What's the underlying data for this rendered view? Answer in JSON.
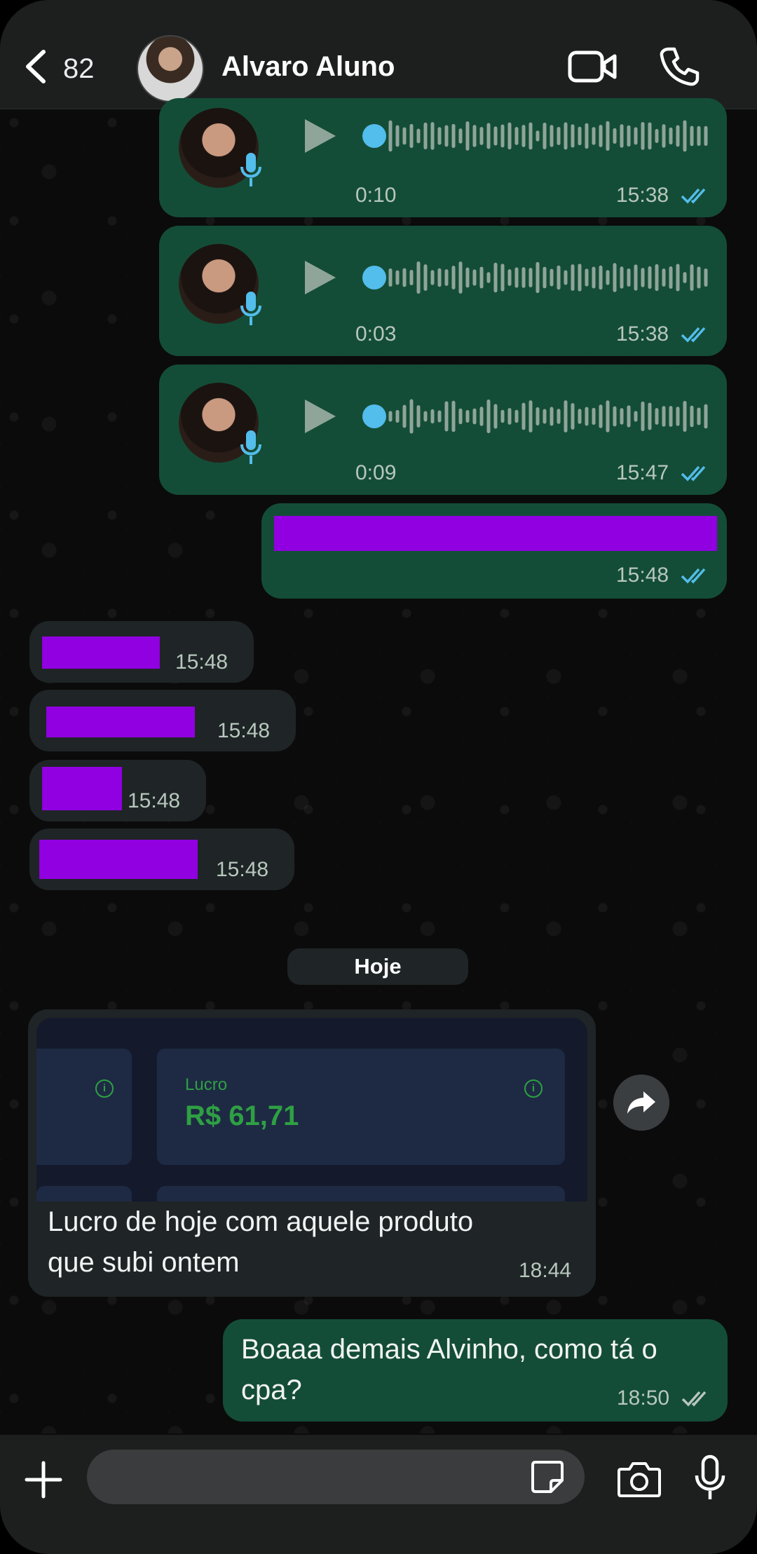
{
  "header": {
    "unread_count": "82",
    "contact_name": "Alvaro Aluno"
  },
  "voice_messages": [
    {
      "duration": "0:10",
      "time": "15:38"
    },
    {
      "duration": "0:03",
      "time": "15:38"
    },
    {
      "duration": "0:09",
      "time": "15:47"
    }
  ],
  "redacted_outgoing": {
    "time": "15:48"
  },
  "redacted_incoming": [
    {
      "time": "15:48"
    },
    {
      "time": "15:48"
    },
    {
      "time": "15:48"
    },
    {
      "time": "15:48"
    }
  ],
  "day_separator": "Hoje",
  "image_message": {
    "card_label": "Lucro",
    "card_value": "R$ 61,71",
    "info_glyph": "i",
    "caption_line1": "Lucro de hoje com aquele produto",
    "caption_line2": "que subi ontem",
    "time": "18:44"
  },
  "reply_message": {
    "line1": "Boaaa demais Alvinho, como tá o",
    "line2": "cpa?",
    "time": "18:50"
  },
  "input": {
    "placeholder": ""
  },
  "colors": {
    "outgoing_bubble": "#144d37",
    "incoming_bubble": "#1f2426",
    "read_ticks": "#53bdeb",
    "redaction": "#9000e0",
    "profit_green": "#2ea043"
  },
  "icons": [
    "back-chevron-icon",
    "video-call-icon",
    "phone-icon",
    "play-icon",
    "mic-icon",
    "double-check-icon",
    "forward-icon",
    "plus-icon",
    "sticker-icon",
    "camera-icon"
  ]
}
